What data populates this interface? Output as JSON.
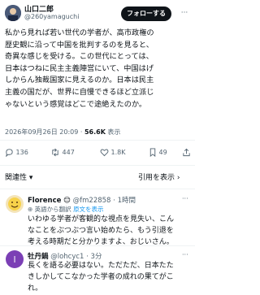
{
  "post": {
    "author_name": "山口二郎",
    "author_handle": "@260yamaguchi",
    "follow_label": "フォローする",
    "more_glyph": "···",
    "text_lines": [
      "私から見れば若い世代の学者が、高市政権の",
      "歴史観に沿って中国を批判するのを見ると、",
      "奇異な感じを受ける。この世代にとっては、",
      "日本はつねに民主主義陣営にいて、中国はげ",
      "しからん独裁国家に見えるのか。日本は民主",
      "主義の国だが、世界に自慢できるほど立派じ",
      "ゃないという感覚はどこで途絶えたのか。"
    ],
    "timestamp": "2026年09月26日 20:09 · ",
    "views_count": "56.6K",
    "views_label": " 表示"
  },
  "actions": {
    "reply_count": "136",
    "repost_count": "447",
    "like_count": "1.8K",
    "bookmark_count": "49"
  },
  "sort": {
    "left_label": "関連性 ▾",
    "right_label": "引用を表示 ›"
  },
  "replies": [
    {
      "name": "Florence",
      "emoji": "😊",
      "handle": "@fm22858 · 1時間",
      "translate_prefix": "英語から翻訳 ",
      "translate_link": "原文を表示",
      "text_lines": [
        "いわゆる学者が客観的な視点を見失い、こん",
        "なことをぶつぶつ言い始めたら、もう引退を",
        "考える時期だと分かりますよ、おじいさん。"
      ]
    },
    {
      "name": "牡丹鍋",
      "emoji": "",
      "handle": "@lohcyc1 · 3分",
      "translate_prefix": "",
      "translate_link": "",
      "text_lines": [
        "長くを語る必要はない。ただただ、日本たた",
        "きしかしてこなかった学者の成れの果てがこ",
        "れ。"
      ]
    }
  ],
  "colors": {
    "text": "#0f1419",
    "secondary": "#536471",
    "link": "#1d9bf0",
    "divider": "#eff3f4"
  }
}
